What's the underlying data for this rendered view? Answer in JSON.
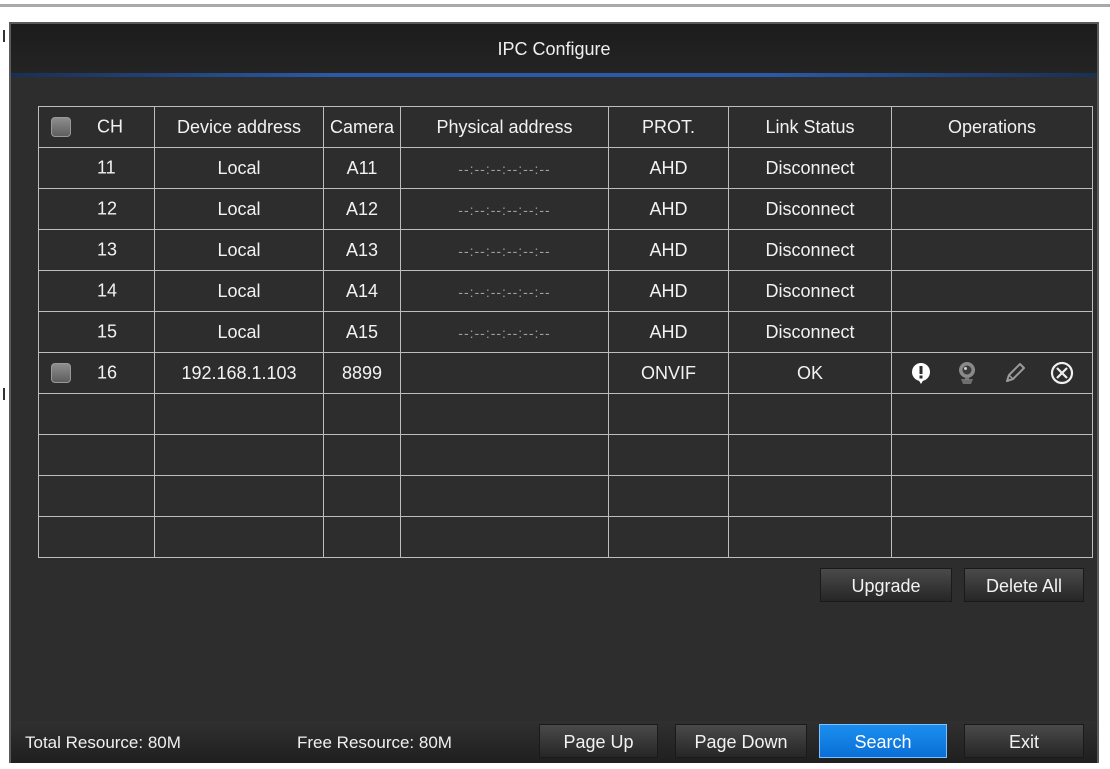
{
  "window": {
    "title": "IPC Configure"
  },
  "table": {
    "headers": [
      "CH",
      "Device address",
      "Camera",
      "Physical address",
      "PROT.",
      "Link Status",
      "Operations"
    ],
    "rows": [
      {
        "ch": "11",
        "device_address": "Local",
        "camera": "A11",
        "physical_address": "--:--:--:--:--:--",
        "protocol": "AHD",
        "link_status": "Disconnect"
      },
      {
        "ch": "12",
        "device_address": "Local",
        "camera": "A12",
        "physical_address": "--:--:--:--:--:--",
        "protocol": "AHD",
        "link_status": "Disconnect"
      },
      {
        "ch": "13",
        "device_address": "Local",
        "camera": "A13",
        "physical_address": "--:--:--:--:--:--",
        "protocol": "AHD",
        "link_status": "Disconnect"
      },
      {
        "ch": "14",
        "device_address": "Local",
        "camera": "A14",
        "physical_address": "--:--:--:--:--:--",
        "protocol": "AHD",
        "link_status": "Disconnect"
      },
      {
        "ch": "15",
        "device_address": "Local",
        "camera": "A15",
        "physical_address": "--:--:--:--:--:--",
        "protocol": "AHD",
        "link_status": "Disconnect"
      },
      {
        "ch": "16",
        "device_address": "192.168.1.103",
        "camera": "8899",
        "physical_address": "",
        "protocol": "ONVIF",
        "link_status": "OK"
      }
    ],
    "operation_icons": [
      "info-icon",
      "camera-icon",
      "edit-icon",
      "delete-icon"
    ]
  },
  "actions": {
    "upgrade": "Upgrade",
    "delete_all": "Delete All"
  },
  "footer": {
    "total_resource": "Total Resource: 80M",
    "free_resource": "Free Resource: 80M",
    "page_up": "Page Up",
    "page_down": "Page Down",
    "search": "Search",
    "exit": "Exit"
  },
  "colors": {
    "panel_bg": "#2d2d2d",
    "accent_blue": "#1b8ef0",
    "grid_line": "#bdbdbd",
    "text": "#f2f2f2"
  }
}
